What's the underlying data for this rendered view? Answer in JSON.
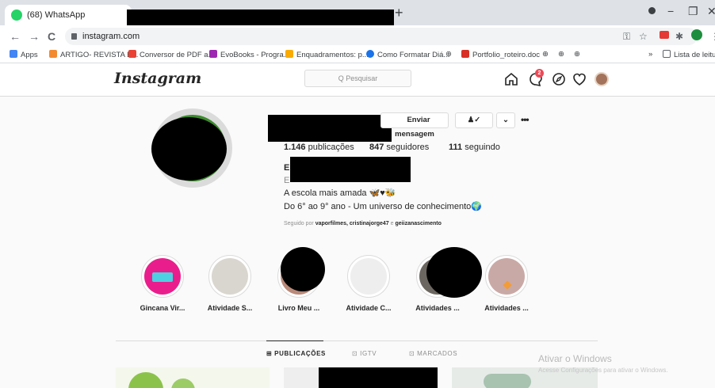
{
  "browser": {
    "tabs": [
      {
        "label": "(68) WhatsApp",
        "favicon_color": "#25d366"
      }
    ],
    "new_tab_symbol": "+",
    "url": "instagram.com",
    "window_controls": {
      "minimize": "−",
      "maximize": "❐",
      "close": "✕"
    },
    "nav": {
      "back": "←",
      "forward": "→",
      "reload": "C"
    }
  },
  "bookmarks": [
    {
      "label": "Apps",
      "color": "#4285f4"
    },
    {
      "label": "ARTIGO- REVISTA E...",
      "color": "#f28b30"
    },
    {
      "label": "Conversor de PDF a...",
      "color": "#e94235"
    },
    {
      "label": "EvoBooks - Progra...",
      "color": "#9c27b0"
    },
    {
      "label": "Enquadramentos: p...",
      "color": "#f9ab00"
    },
    {
      "label": "Como Formatar Diá...",
      "color": "#1a73e8"
    },
    {
      "label": "Portfolio_roteiro.doc",
      "color": "#d93025"
    }
  ],
  "bookmarks_overflow": "»",
  "reading_list": "Lista de leitura",
  "instagram": {
    "logo": "Instagram",
    "search_placeholder": "Q Pesquisar",
    "notification_count": "2"
  },
  "profile": {
    "message_button": "Enviar mensagem",
    "more": "•••",
    "stats": {
      "posts_value": "1.146",
      "posts_label": "publicações",
      "followers_value": "847",
      "followers_label": "seguidores",
      "following_value": "111",
      "following_label": "seguindo"
    },
    "name_initial": "E",
    "category_initial": "E",
    "bio_line1": "A escola mais amada 🦋♥🐝",
    "bio_line2": "Do 6° ao 9° ano - Um universo de conhecimento🌍",
    "followed_by_prefix": "Seguido por",
    "followed_by_names": "vaporfilmes, cristinajorge47",
    "followed_by_and": "e",
    "followed_by_last": "geiizanascimento"
  },
  "highlights": [
    {
      "label": "Gincana Vir...",
      "color": "#e91e8c"
    },
    {
      "label": "Atividade S...",
      "color": "#d9d6cf"
    },
    {
      "label": "Livro Meu ...",
      "color": "#000000"
    },
    {
      "label": "Atividade C...",
      "color": "#eeeeee"
    },
    {
      "label": "Atividades ...",
      "color": "#6b6660"
    },
    {
      "label": "Atividades ...",
      "color": "#c9a9a6"
    }
  ],
  "profile_tabs": [
    {
      "label": "PUBLICAÇÕES",
      "icon": "⊞",
      "active": true
    },
    {
      "label": "IGTV",
      "icon": "⊡",
      "active": false
    },
    {
      "label": "MARCADOS",
      "icon": "⊡",
      "active": false
    }
  ],
  "watermark": {
    "title": "Ativar o Windows",
    "subtitle": "Acesse Configurações para ativar o Windows."
  }
}
